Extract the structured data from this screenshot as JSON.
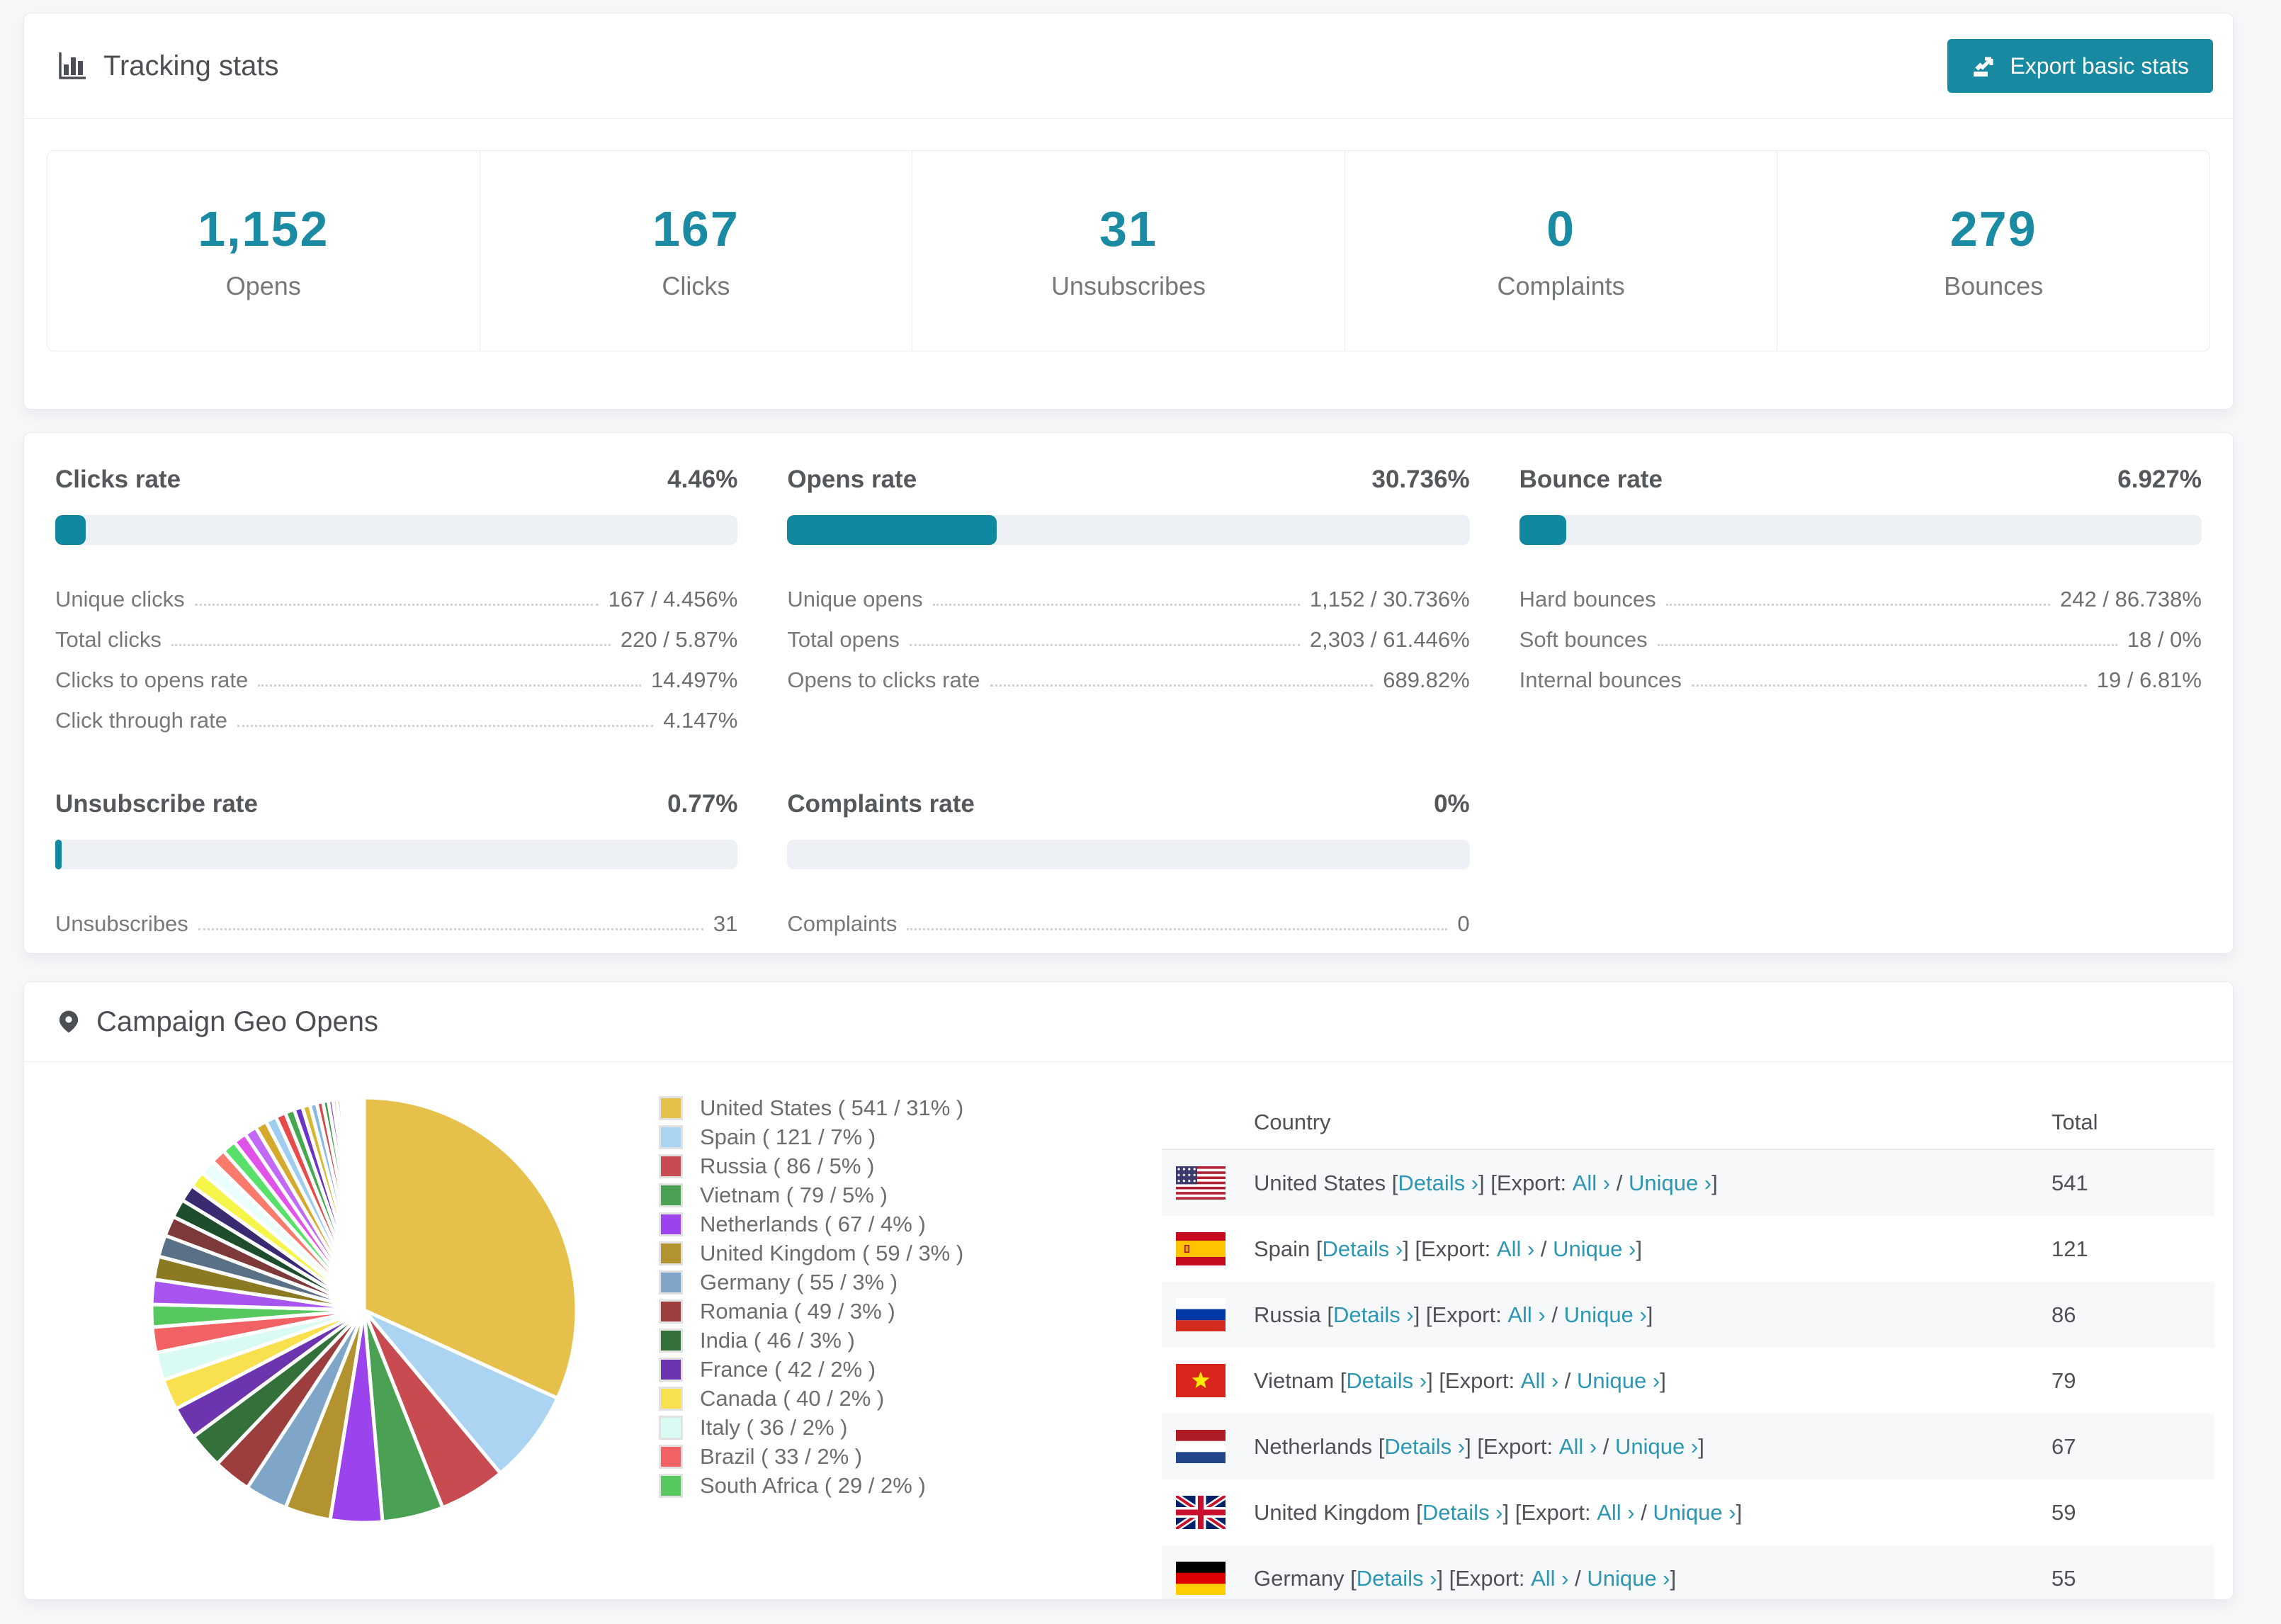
{
  "page": {
    "background": "#f7f8f9",
    "accent_teal": "#1789a0",
    "stat_number_color": "#1b8ba3",
    "link_color": "#2d96b2"
  },
  "icons": {
    "tracking_header": "bar-chart-icon",
    "export_button": "export-icon",
    "geo_header": "map-pin-icon"
  },
  "tracking": {
    "title": "Tracking stats",
    "export_button_label": "Export basic stats",
    "stats": [
      {
        "value": "1,152",
        "label": "Opens"
      },
      {
        "value": "167",
        "label": "Clicks"
      },
      {
        "value": "31",
        "label": "Unsubscribes"
      },
      {
        "value": "0",
        "label": "Complaints"
      },
      {
        "value": "279",
        "label": "Bounces"
      }
    ]
  },
  "rates": [
    {
      "id": "clicks",
      "title": "Clicks rate",
      "value": "4.46%",
      "percent": 4.46,
      "rows": [
        [
          "Unique clicks",
          "167 / 4.456%"
        ],
        [
          "Total clicks",
          "220 / 5.87%"
        ],
        [
          "Clicks to opens rate",
          "14.497%"
        ],
        [
          "Click through rate",
          "4.147%"
        ]
      ]
    },
    {
      "id": "opens",
      "title": "Opens rate",
      "value": "30.736%",
      "percent": 30.736,
      "rows": [
        [
          "Unique opens",
          "1,152 / 30.736%"
        ],
        [
          "Total opens",
          "2,303 / 61.446%"
        ],
        [
          "Opens to clicks rate",
          "689.82%"
        ]
      ]
    },
    {
      "id": "bounce",
      "title": "Bounce rate",
      "value": "6.927%",
      "percent": 6.927,
      "rows": [
        [
          "Hard bounces",
          "242 / 86.738%"
        ],
        [
          "Soft bounces",
          "18 / 0%"
        ],
        [
          "Internal bounces",
          "19 / 6.81%"
        ]
      ]
    },
    {
      "id": "unsubscribe",
      "title": "Unsubscribe rate",
      "value": "0.77%",
      "percent": 0.77,
      "rows": [
        [
          "Unsubscribes",
          "31"
        ]
      ]
    },
    {
      "id": "complaints",
      "title": "Complaints rate",
      "value": "0%",
      "percent": 0,
      "rows": [
        [
          "Complaints",
          "0"
        ]
      ]
    }
  ],
  "geo": {
    "title": "Campaign Geo Opens",
    "chart_data": {
      "type": "pie",
      "title": "Campaign Geo Opens",
      "legend_position": "right",
      "start_angle_deg": -90,
      "direction": "clockwise",
      "labels": [
        "United States",
        "Spain",
        "Russia",
        "Vietnam",
        "Netherlands",
        "United Kingdom",
        "Germany",
        "Romania",
        "India",
        "France",
        "Canada",
        "Italy",
        "Brazil",
        "South Africa"
      ],
      "values": [
        541,
        121,
        86,
        79,
        67,
        59,
        55,
        49,
        46,
        42,
        40,
        36,
        33,
        29
      ],
      "percents": [
        "31%",
        "7%",
        "5%",
        "5%",
        "4%",
        "3%",
        "3%",
        "3%",
        "3%",
        "2%",
        "2%",
        "2%",
        "2%",
        "2%"
      ],
      "colors": [
        "#e5c04a",
        "#aad4f2",
        "#c84b52",
        "#4ba153",
        "#9b44ee",
        "#b2932f",
        "#7fa6c9",
        "#9c3e3e",
        "#33703a",
        "#6c34ae",
        "#f8e04e",
        "#d9fbf4",
        "#f26163",
        "#57c75f"
      ],
      "others": {
        "note": "unlabeled thin slices, values estimated from pixels",
        "values": [
          32,
          30,
          28,
          26,
          24,
          22,
          21,
          20,
          19,
          18,
          17,
          16,
          15,
          14,
          13,
          12,
          11,
          10,
          9,
          8,
          7,
          6,
          5,
          5,
          4,
          4,
          3,
          3,
          2,
          2,
          2,
          2,
          1,
          1,
          1,
          1,
          1,
          1,
          1,
          1
        ],
        "palette": [
          "#a855f0",
          "#8a7a22",
          "#5a7086",
          "#7e3a3a",
          "#1e4d2b",
          "#3a2a72",
          "#f5f54a",
          "#eafffb",
          "#fa7a6e",
          "#58e06a",
          "#e052e8",
          "#c06af5",
          "#d4a92c",
          "#9fcdf2",
          "#e84a4a",
          "#44a84e",
          "#6a34c8",
          "#d8b832",
          "#86b8e8",
          "#d84848",
          "#3a9a44",
          "#8a4ae0"
        ]
      }
    },
    "legend_format": {
      "open": " ( ",
      "sep": " / ",
      "close": " )"
    },
    "table": {
      "headers": [
        "Country",
        "Total"
      ],
      "link_parts": {
        "open": " [",
        "details": "Details ›",
        "mid": "] [Export: ",
        "all": "All ›",
        "slash": " / ",
        "unique": "Unique ›",
        "close": "]"
      },
      "rows": [
        {
          "flag": "us",
          "country": "United States",
          "total": "541"
        },
        {
          "flag": "es",
          "country": "Spain",
          "total": "121"
        },
        {
          "flag": "ru",
          "country": "Russia",
          "total": "86"
        },
        {
          "flag": "vn",
          "country": "Vietnam",
          "total": "79"
        },
        {
          "flag": "nl",
          "country": "Netherlands",
          "total": "67"
        },
        {
          "flag": "gb",
          "country": "United Kingdom",
          "total": "59"
        },
        {
          "flag": "de",
          "country": "Germany",
          "total": "55",
          "partial": true
        }
      ]
    }
  }
}
